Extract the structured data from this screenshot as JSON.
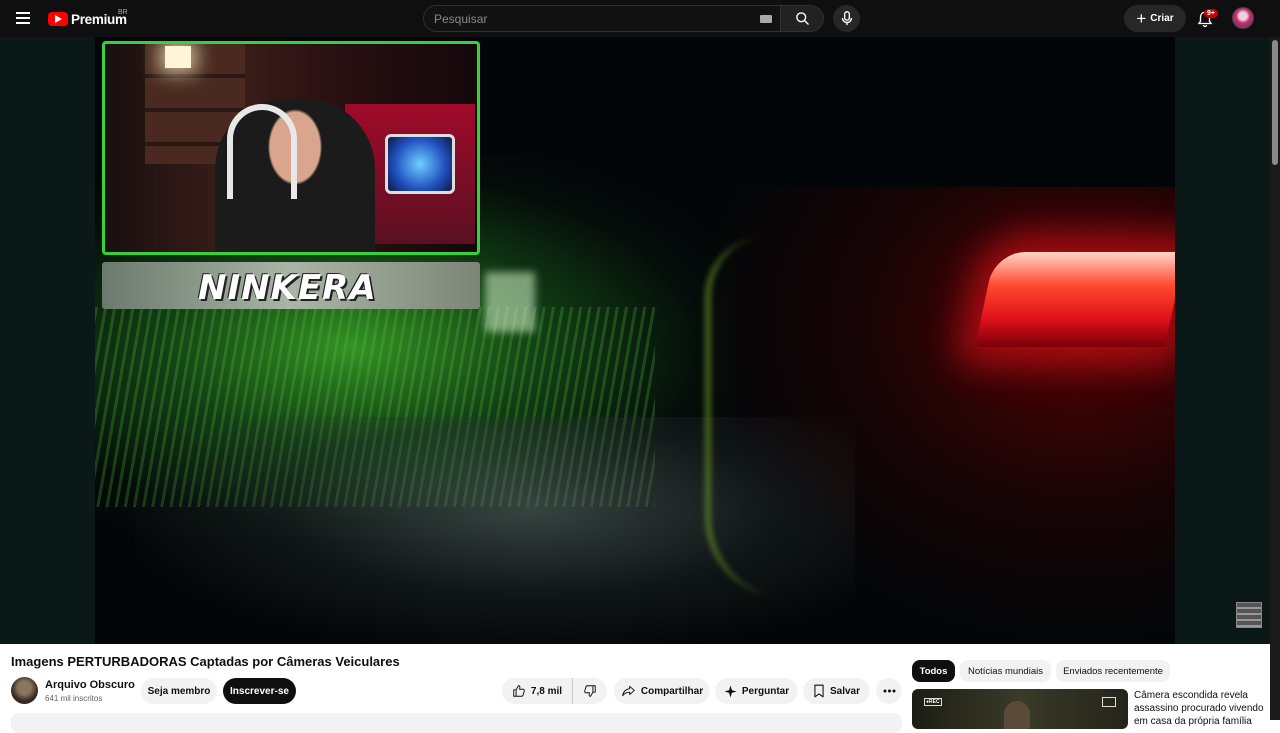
{
  "header": {
    "brand": "Premium",
    "region": "BR",
    "search_placeholder": "Pesquisar",
    "create_label": "Criar",
    "notifications_badge": "9+"
  },
  "video": {
    "title": "Imagens PERTURBADORAS Captadas por Câmeras Veiculares",
    "overlay_banner": "NINKERA"
  },
  "channel": {
    "name": "Arquivo Obscuro",
    "subscribers": "641 mil inscritos",
    "member_label": "Seja membro",
    "subscribe_label": "Inscrever-se"
  },
  "actions": {
    "likes": "7,8 mil",
    "share_label": "Compartilhar",
    "ask_label": "Perguntar",
    "save_label": "Salvar"
  },
  "sidebar": {
    "chips": [
      "Todos",
      "Notícias mundiais",
      "Enviados recentemente"
    ],
    "recommendation_title": "Câmera escondida revela assassino procurado vivendo em casa da própria família"
  },
  "colors": {
    "accent": "#ff0000",
    "header_bg": "#0f0f0f",
    "webcam_border": "#35d23a"
  },
  "icons": [
    "menu-icon",
    "youtube-logo-icon",
    "keyboard-icon",
    "search-icon",
    "mic-icon",
    "plus-icon",
    "bell-icon",
    "like-icon",
    "dislike-icon",
    "share-icon",
    "sparkle-icon",
    "bookmark-icon",
    "more-icon"
  ]
}
